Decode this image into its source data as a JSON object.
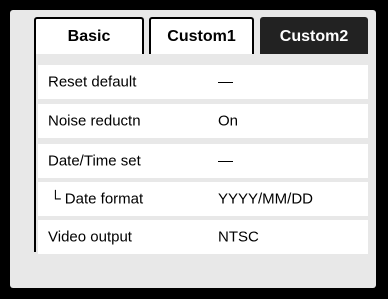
{
  "tabs": [
    {
      "label": "Basic"
    },
    {
      "label": "Custom1"
    },
    {
      "label": "Custom2",
      "active": true
    }
  ],
  "menu": {
    "items": [
      {
        "label": "Reset default",
        "value": "—"
      },
      {
        "label": "Noise reductn",
        "value": "On"
      },
      {
        "label": "Date/Time set",
        "value": "—"
      },
      {
        "label": "└ Date format",
        "value": "YYYY/MM/DD"
      },
      {
        "label": "Video output",
        "value": "NTSC"
      }
    ]
  },
  "colors": {
    "outer_background": "#000000",
    "panel_background": "#e8e8e8",
    "row_background": "#ffffff",
    "active_tab_background": "#222222",
    "active_tab_text": "#ffffff"
  }
}
